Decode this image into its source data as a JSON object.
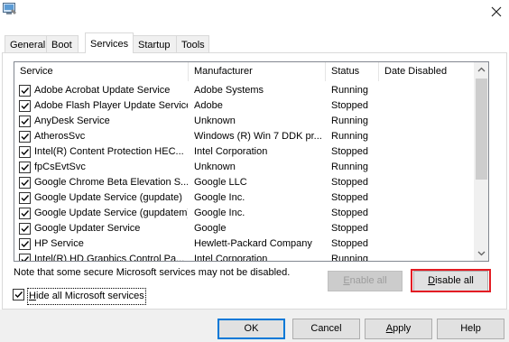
{
  "window": {
    "close_glyph": "✕",
    "app_icon": "msconfig-icon"
  },
  "tabs": [
    {
      "label": "General",
      "active": false
    },
    {
      "label": "Boot",
      "active": false
    },
    {
      "label": "Services",
      "active": true
    },
    {
      "label": "Startup",
      "active": false
    },
    {
      "label": "Tools",
      "active": false
    }
  ],
  "columns": {
    "service": "Service",
    "manufacturer": "Manufacturer",
    "status": "Status",
    "date_disabled": "Date Disabled"
  },
  "services": [
    {
      "checked": true,
      "name": "Adobe Acrobat Update Service",
      "manufacturer": "Adobe Systems",
      "status": "Running",
      "date": ""
    },
    {
      "checked": true,
      "name": "Adobe Flash Player Update Service",
      "manufacturer": "Adobe",
      "status": "Stopped",
      "date": ""
    },
    {
      "checked": true,
      "name": "AnyDesk Service",
      "manufacturer": "Unknown",
      "status": "Running",
      "date": ""
    },
    {
      "checked": true,
      "name": "AtherosSvc",
      "manufacturer": "Windows (R) Win 7 DDK pr...",
      "status": "Running",
      "date": ""
    },
    {
      "checked": true,
      "name": "Intel(R) Content Protection HEC...",
      "manufacturer": "Intel Corporation",
      "status": "Stopped",
      "date": ""
    },
    {
      "checked": true,
      "name": "fpCsEvtSvc",
      "manufacturer": "Unknown",
      "status": "Running",
      "date": ""
    },
    {
      "checked": true,
      "name": "Google Chrome Beta Elevation S...",
      "manufacturer": "Google LLC",
      "status": "Stopped",
      "date": ""
    },
    {
      "checked": true,
      "name": "Google Update Service (gupdate)",
      "manufacturer": "Google Inc.",
      "status": "Stopped",
      "date": ""
    },
    {
      "checked": true,
      "name": "Google Update Service (gupdatem)",
      "manufacturer": "Google Inc.",
      "status": "Stopped",
      "date": ""
    },
    {
      "checked": true,
      "name": "Google Updater Service",
      "manufacturer": "Google",
      "status": "Stopped",
      "date": ""
    },
    {
      "checked": true,
      "name": "HP Service",
      "manufacturer": "Hewlett-Packard Company",
      "status": "Stopped",
      "date": ""
    },
    {
      "checked": true,
      "name": "Intel(R) HD Graphics Control Pa...",
      "manufacturer": "Intel Corporation",
      "status": "Running",
      "date": ""
    }
  ],
  "note": "Note that some secure Microsoft services may not be disabled.",
  "buttons": {
    "enable_all": {
      "label": "Enable all",
      "mnemonic": "E",
      "rest": "nable all",
      "enabled": false
    },
    "disable_all": {
      "label": "Disable all",
      "mnemonic": "D",
      "rest": "isable all",
      "enabled": true
    }
  },
  "hide_microsoft": {
    "checked": true,
    "label": "Hide all Microsoft services",
    "mnemonic": "H",
    "rest": "ide all Microsoft services"
  },
  "footer": {
    "ok": "OK",
    "cancel": "Cancel",
    "apply": {
      "mnemonic": "A",
      "rest": "pply"
    },
    "help": "Help"
  },
  "annotation_colors": {
    "highlight": "#e31b23"
  }
}
